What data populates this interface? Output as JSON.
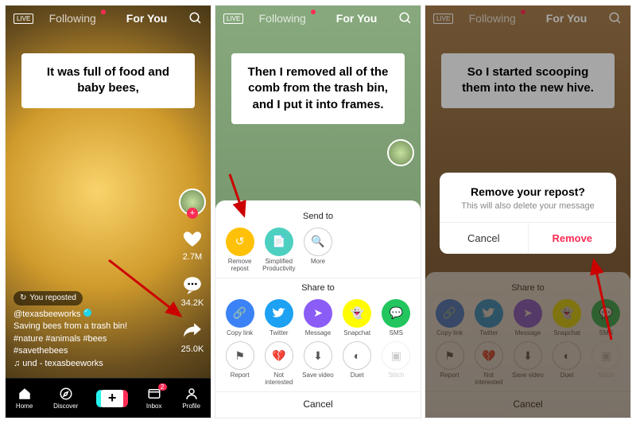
{
  "header": {
    "live": "LIVE",
    "following": "Following",
    "foryou": "For You"
  },
  "pane1": {
    "caption": "It was full of food and baby bees,",
    "likes": "2.7M",
    "comments": "34.2K",
    "shares": "25.0K",
    "reposted_label": "You reposted",
    "username": "@texasbeeworks",
    "desc": "Saving bees from a trash bin! #nature #animals #bees #savethebees",
    "sound": "♫  und - texasbeeworks"
  },
  "nav": {
    "home": "Home",
    "discover": "Discover",
    "inbox": "Inbox",
    "inbox_badge": "2",
    "profile": "Profile"
  },
  "pane2": {
    "caption": "Then I removed all of the comb from the trash bin, and I put it into frames.",
    "send_to": "Send to",
    "share_to": "Share to",
    "send": {
      "remove_repost": "Remove repost",
      "simplified": "Simplified Productivity",
      "more": "More"
    },
    "share": {
      "copy_link": "Copy link",
      "twitter": "Twitter",
      "message": "Message",
      "snapchat": "Snapchat",
      "sms": "SMS"
    },
    "action": {
      "report": "Report",
      "not_interested": "Not interested",
      "save_video": "Save video",
      "duet": "Duet",
      "stitch": "Stitch"
    },
    "cancel": "Cancel"
  },
  "pane3": {
    "caption": "So I started scooping them into the new hive.",
    "dialog_title": "Remove your repost?",
    "dialog_body": "This will also delete your message",
    "cancel": "Cancel",
    "remove": "Remove"
  }
}
